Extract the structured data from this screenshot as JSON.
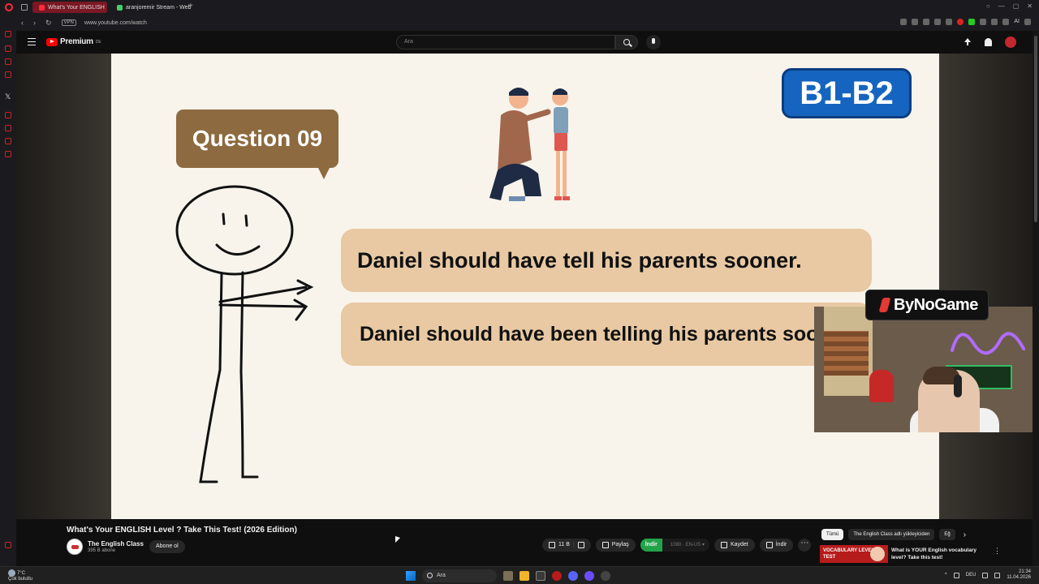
{
  "browser": {
    "tabs": [
      {
        "label": "What's Your ENGLISH"
      },
      {
        "label": "aranjoremir Stream - Web"
      }
    ],
    "url": "www.youtube.com/watch",
    "vpn_label": "VPN",
    "ai_label": "AI"
  },
  "youtube": {
    "logo_text": "Premium",
    "logo_sup": "DE",
    "search_placeholder": "Ara"
  },
  "slide": {
    "question_label": "Question 09",
    "level_badge": "B1-B2",
    "option_1": "Daniel should have tell his parents sooner.",
    "option_2": "Daniel should have been telling his parents sooner."
  },
  "overlay": {
    "brand": "ByNoGame"
  },
  "video": {
    "title": "What's Your ENGLISH Level ? Take This Test! (2026 Edition)",
    "channel_name": "The English Class",
    "subscribers": "395 B abone",
    "subscribe_label": "Abone ol",
    "likes": "11 B",
    "share_label": "Paylaş",
    "download_green_label": "İndir",
    "download_quality": "1080 · EN-US ▾",
    "save_label": "Kaydet",
    "download_label": "İndir"
  },
  "recommendations": {
    "chips": [
      "Tümü",
      "The English Class adlı yükleyiciden",
      "Eğ"
    ],
    "item": {
      "thumb_text": "VOCABULARY LEVEL TEST",
      "title": "What is YOUR English vocabulary level? Take this test!"
    }
  },
  "taskbar": {
    "weather_temp": "7°C",
    "weather_desc": "Çok bulutlu",
    "search_label": "Ara",
    "lang": "DEU",
    "time": "21:34",
    "date": "11.04.2026"
  }
}
